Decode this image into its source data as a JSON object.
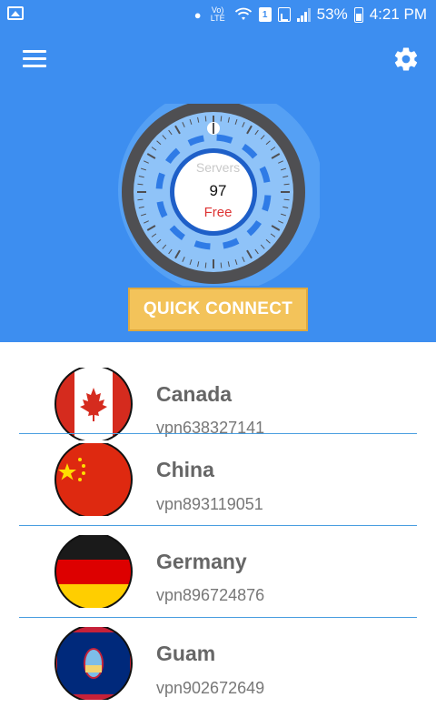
{
  "status_bar": {
    "lte": "Vo) LTE",
    "sim": "1",
    "battery_percent": "53%",
    "time": "4:21 PM"
  },
  "dial": {
    "servers_label": "Servers",
    "servers_count": "97",
    "free_label": "Free"
  },
  "quick_connect_label": "QUICK CONNECT",
  "servers": [
    {
      "country": "Canada",
      "id": "vpn638327141",
      "flag": "canada-flag-icon"
    },
    {
      "country": "China",
      "id": "vpn893119051",
      "flag": "china-flag-icon"
    },
    {
      "country": "Germany",
      "id": "vpn896724876",
      "flag": "germany-flag-icon"
    },
    {
      "country": "Guam",
      "id": "vpn902672649",
      "flag": "guam-flag-icon"
    }
  ],
  "colors": {
    "primary": "#3d8ef0",
    "button": "#f3c35a",
    "divider": "#4a9ee0"
  }
}
